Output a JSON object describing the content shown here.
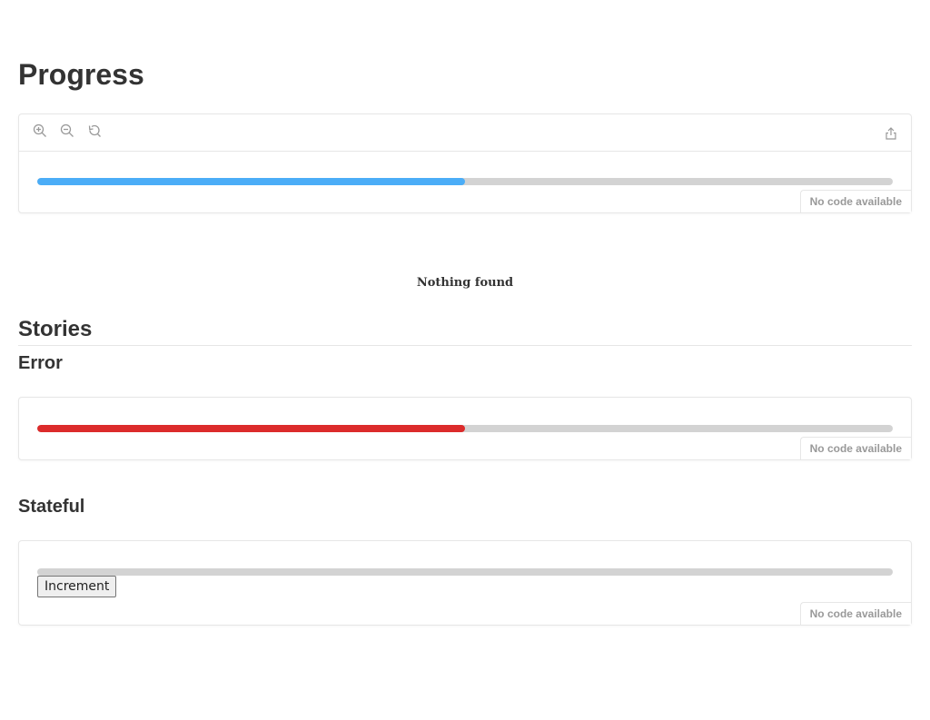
{
  "page": {
    "title": "Progress"
  },
  "main_preview": {
    "toolbar": {
      "icons": [
        "zoom-in-icon",
        "zoom-out-icon",
        "reset-zoom-icon",
        "share-icon"
      ]
    },
    "progress": {
      "value_percent": 50,
      "fill_color": "#4BADF7",
      "track_color": "#D3D3D3"
    },
    "no_code_label": "No code available"
  },
  "nothing_found": "Nothing found",
  "stories": {
    "heading": "Stories",
    "error": {
      "heading": "Error",
      "progress": {
        "value_percent": 50,
        "fill_color": "#DC2B2B",
        "track_color": "#D3D3D3"
      },
      "no_code_label": "No code available"
    },
    "stateful": {
      "heading": "Stateful",
      "progress": {
        "value_percent": 0,
        "fill_color": "#4BADF7",
        "track_color": "#D3D3D3"
      },
      "button_label": "Increment",
      "no_code_label": "No code available"
    }
  }
}
